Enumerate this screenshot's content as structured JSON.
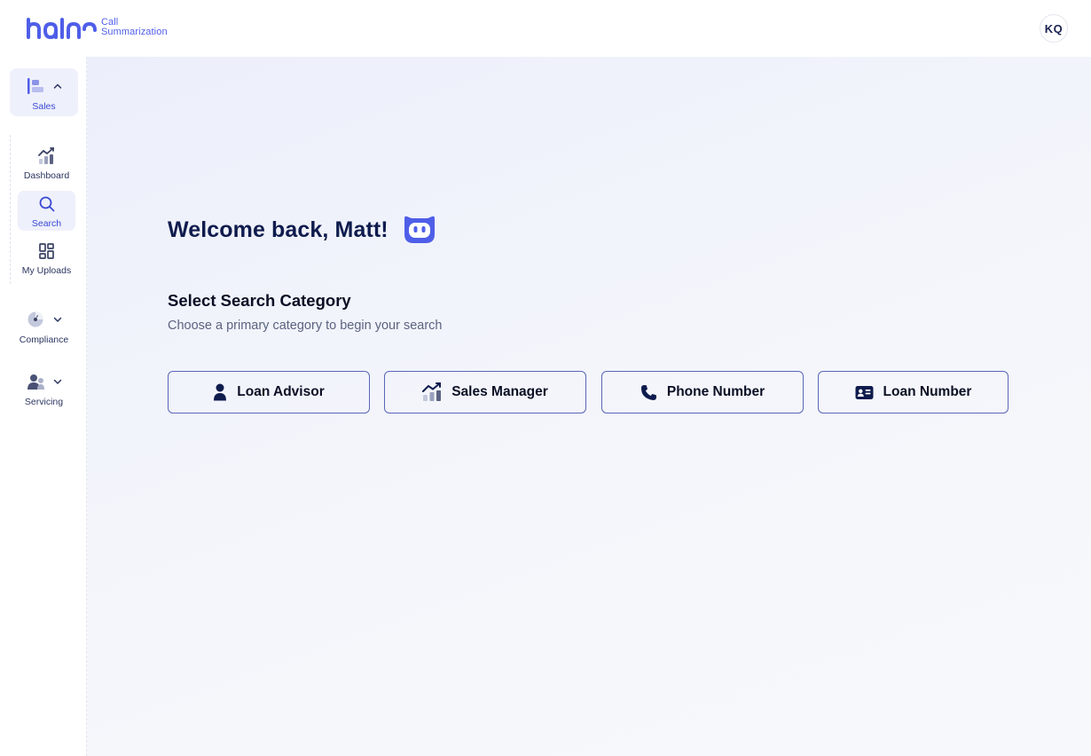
{
  "header": {
    "logo_line1": "Call",
    "logo_line2": "Summarization",
    "avatar_initials": "KQ"
  },
  "sidebar": {
    "groups": [
      {
        "label": "Sales",
        "icon": "sales-icon",
        "expanded": true
      },
      {
        "label": "Compliance",
        "icon": "compliance-icon",
        "expanded": false
      },
      {
        "label": "Servicing",
        "icon": "servicing-icon",
        "expanded": false
      }
    ],
    "items": [
      {
        "label": "Dashboard",
        "icon": "dashboard-icon"
      },
      {
        "label": "Search",
        "icon": "search-icon",
        "active": true
      },
      {
        "label": "My Uploads",
        "icon": "uploads-icon"
      }
    ]
  },
  "main": {
    "welcome": "Welcome back, Matt!",
    "section_title": "Select Search Category",
    "section_subtitle": "Choose a primary category to begin your search",
    "categories": [
      {
        "label": "Loan Advisor",
        "icon": "person-icon"
      },
      {
        "label": "Sales Manager",
        "icon": "chart-trend-icon"
      },
      {
        "label": "Phone Number",
        "icon": "phone-icon"
      },
      {
        "label": "Loan Number",
        "icon": "id-card-icon"
      }
    ]
  },
  "colors": {
    "accent": "#4f5ee8",
    "nav_active_bg": "#eef0fb",
    "heading": "#0e1b4d",
    "button_border": "#5966b8"
  }
}
